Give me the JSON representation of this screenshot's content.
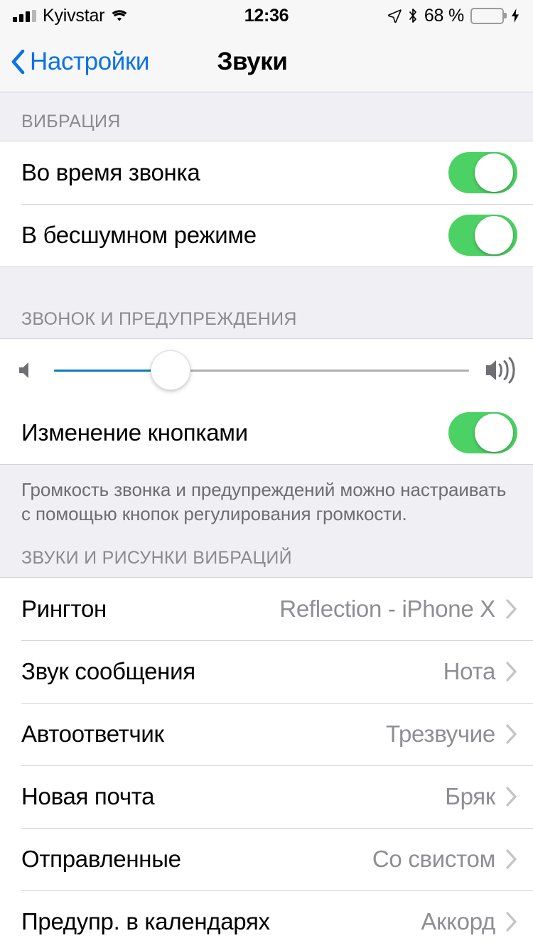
{
  "status_bar": {
    "carrier": "Kyivstar",
    "time": "12:36",
    "battery_percent": "68 %",
    "battery_level": 68,
    "icons": [
      "signal-bars-icon",
      "wifi-icon",
      "location-arrow-icon",
      "bluetooth-icon",
      "battery-icon",
      "charging-bolt-icon"
    ]
  },
  "nav": {
    "back_label": "Настройки",
    "title": "Звуки"
  },
  "colors": {
    "accent_blue": "#0b72e7",
    "toggle_green": "#4cd264",
    "slider_blue": "#0b7ec0",
    "group_bg": "#efeff4",
    "value_gray": "#8e8e93"
  },
  "sections": [
    {
      "header": "ВИБРАЦИЯ",
      "rows": [
        {
          "label": "Во время звонка",
          "control": "toggle",
          "value": "on"
        },
        {
          "label": "В бесшумном режиме",
          "control": "toggle",
          "value": "on"
        }
      ]
    },
    {
      "header": "ЗВОНОК И ПРЕДУПРЕЖДЕНИЯ",
      "slider": {
        "name": "ringer-volume-slider",
        "value_percent": 28,
        "min_icon": "speaker-low-icon",
        "max_icon": "speaker-high-icon"
      },
      "rows": [
        {
          "label": "Изменение кнопками",
          "control": "toggle",
          "value": "on"
        }
      ],
      "footer": "Громкость звонка и предупреждений можно настраивать с помощью кнопок регулирования громкости."
    },
    {
      "header": "ЗВУКИ И РИСУНКИ ВИБРАЦИЙ",
      "rows": [
        {
          "label": "Рингтон",
          "control": "disclosure",
          "value": "Reflection - iPhone X"
        },
        {
          "label": "Звук сообщения",
          "control": "disclosure",
          "value": "Нота"
        },
        {
          "label": "Автоответчик",
          "control": "disclosure",
          "value": "Трезвучие"
        },
        {
          "label": "Новая почта",
          "control": "disclosure",
          "value": "Бряк"
        },
        {
          "label": "Отправленные",
          "control": "disclosure",
          "value": "Со свистом"
        },
        {
          "label": "Предупр. в календарях",
          "control": "disclosure",
          "value": "Аккорд"
        }
      ]
    }
  ]
}
